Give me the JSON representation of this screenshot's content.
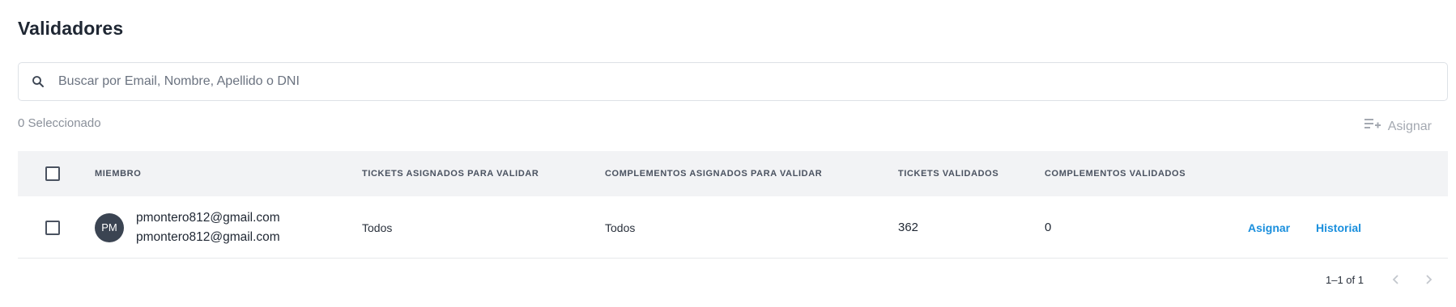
{
  "page": {
    "title": "Validadores"
  },
  "search": {
    "placeholder": "Buscar por Email, Nombre, Apellido o DNI"
  },
  "selection": {
    "count_text": "0 Seleccionado",
    "assign_label": "Asignar"
  },
  "table": {
    "headers": {
      "member": "MIEMBRO",
      "tickets_assigned": "TICKETS ASIGNADOS PARA VALIDAR",
      "complements_assigned": "COMPLEMENTOS ASIGNADOS PARA VALIDAR",
      "tickets_validated": "TICKETS VALIDADOS",
      "complements_validated": "COMPLEMENTOS VALIDADOS"
    },
    "rows": [
      {
        "initials": "PM",
        "name": "pmontero812@gmail.com",
        "email": "pmontero812@gmail.com",
        "tickets_assigned": "Todos",
        "complements_assigned": "Todos",
        "tickets_validated": "362",
        "complements_validated": "0",
        "actions": {
          "assign": "Asignar",
          "history": "Historial"
        }
      }
    ]
  },
  "pagination": {
    "range": "1–1 of 1"
  },
  "colors": {
    "accent_link": "#1a8fdd",
    "avatar_bg": "#3b4452",
    "header_bg": "#f2f3f5",
    "muted_text": "#8a909a"
  },
  "icons": {
    "search": "search-icon",
    "assign": "playlist-add-icon",
    "prev": "chevron-left-icon",
    "next": "chevron-right-icon"
  }
}
